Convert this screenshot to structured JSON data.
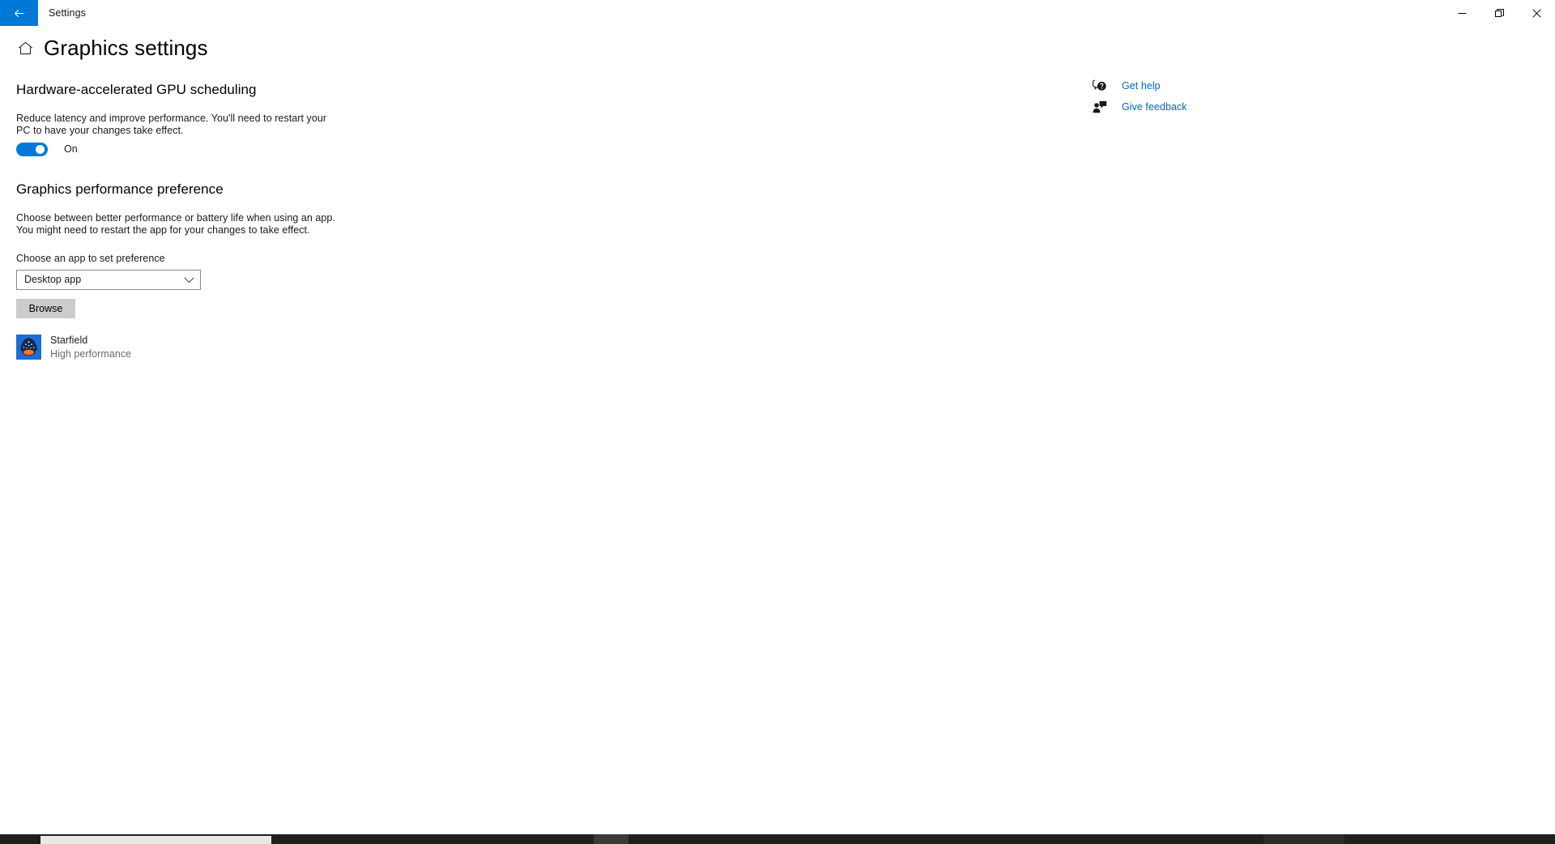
{
  "window": {
    "titlebar_title": "Settings",
    "back_icon": "arrow-left-icon",
    "back_accent_color": "#0078d7",
    "controls": [
      {
        "name": "minimize",
        "icon": "minimize-icon"
      },
      {
        "name": "restore",
        "icon": "restore-icon"
      },
      {
        "name": "close",
        "icon": "close-icon"
      }
    ]
  },
  "page": {
    "home_icon": "home-icon",
    "title": "Graphics settings"
  },
  "sections": {
    "gpu_scheduling": {
      "heading": "Hardware-accelerated GPU scheduling",
      "description_line1": "Reduce latency and improve performance. You'll need to restart your",
      "description_line2": "PC to have your changes take effect.",
      "toggle": {
        "state_label": "On",
        "checked": true,
        "accent_color": "#0078d7"
      }
    },
    "performance_preference": {
      "heading": "Graphics performance preference",
      "description_line1": "Choose between better performance or battery life when using an app.",
      "description_line2": "You might need to restart the app for your changes to take effect.",
      "field_label": "Choose an app to set preference",
      "dropdown": {
        "value": "Desktop app",
        "chevron_icon": "chevron-down-icon",
        "options": [
          "Desktop app"
        ]
      },
      "browse_label": "Browse",
      "apps": [
        {
          "icon": "starfield-app-icon",
          "name": "Starfield",
          "status": "High performance"
        }
      ]
    }
  },
  "right_rail": {
    "links": [
      {
        "icon": "get-help-icon",
        "label": "Get help"
      },
      {
        "icon": "give-feedback-icon",
        "label": "Give feedback"
      }
    ],
    "link_color": "#0067c0"
  }
}
